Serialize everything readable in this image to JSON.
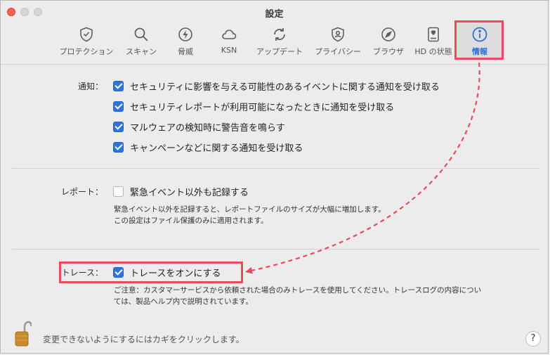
{
  "window": {
    "title": "設定"
  },
  "toolbar": [
    {
      "label": "プロテクション",
      "icon": "shield-icon"
    },
    {
      "label": "スキャン",
      "icon": "magnifier-icon"
    },
    {
      "label": "脅威",
      "icon": "bolt-icon"
    },
    {
      "label": "KSN",
      "icon": "cloud-icon"
    },
    {
      "label": "アップデート",
      "icon": "refresh-icon"
    },
    {
      "label": "プライバシー",
      "icon": "privacy-shield-icon"
    },
    {
      "label": "ブラウザ",
      "icon": "compass-icon"
    },
    {
      "label": "HD の状態",
      "icon": "disk-heart-icon"
    },
    {
      "label": "情報",
      "icon": "info-icon",
      "active": true
    }
  ],
  "notifications": {
    "label": "通知：",
    "items": [
      {
        "text": "セキュリティに影響を与える可能性のあるイベントに関する通知を受け取る",
        "checked": true
      },
      {
        "text": "セキュリティレポートが利用可能になったときに通知を受け取る",
        "checked": true
      },
      {
        "text": "マルウェアの検知時に警告音を鳴らす",
        "checked": true
      },
      {
        "text": "キャンペーンなどに関する通知を受け取る",
        "checked": true
      }
    ]
  },
  "report": {
    "label": "レポート：",
    "item": {
      "text": "緊急イベント以外も記録する",
      "checked": false
    },
    "note_line1": "緊急イベント以外を記録すると、レポートファイルのサイズが大幅に増加します。",
    "note_line2": "この設定はファイル保護のみに適用されます。"
  },
  "trace": {
    "label": "トレース：",
    "item": {
      "text": "トレースをオンにする",
      "checked": true
    },
    "note_line1": "ご注意：カスタマーサービスから依頼された場合のみトレースを使用してください。トレースログの内容につい",
    "note_line2": "ては、製品ヘルプ内で説明されています。"
  },
  "footer": {
    "lock_text": "変更できないようにするにはカギをクリックします。",
    "help_label": "?",
    "lock_icon": "padlock-open-icon"
  },
  "colors": {
    "accent": "#2670d8",
    "checkbox": "#2c75e0",
    "highlight": "#e84b5a"
  }
}
